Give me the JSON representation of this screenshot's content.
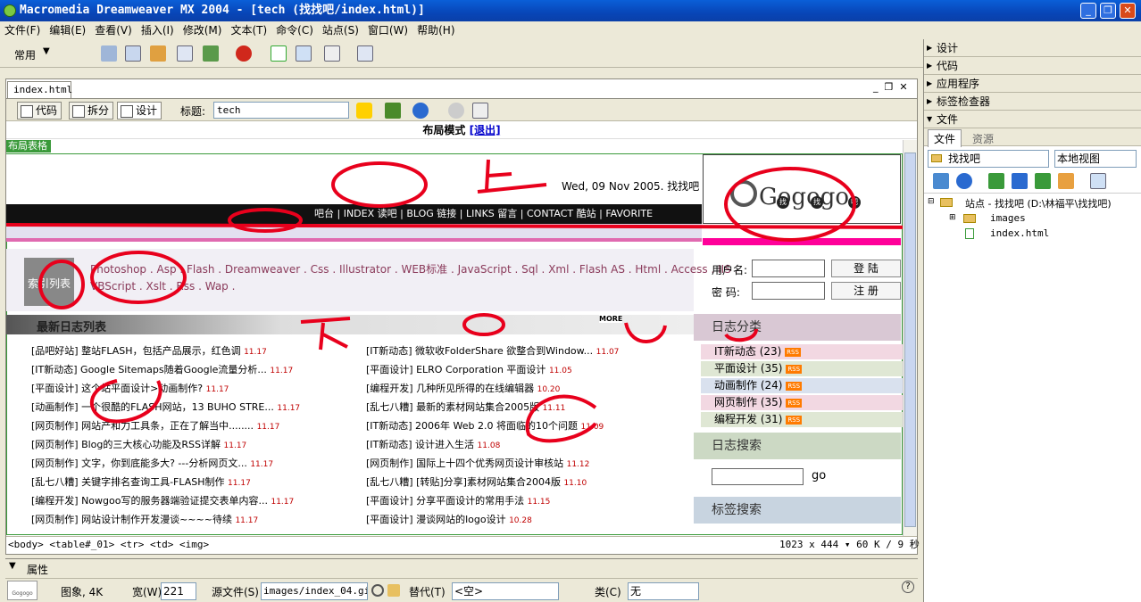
{
  "window": {
    "title": "Macromedia Dreamweaver MX 2004 - [tech (找找吧/index.html)]"
  },
  "menu": [
    "文件(F)",
    "编辑(E)",
    "查看(V)",
    "插入(I)",
    "修改(M)",
    "文本(T)",
    "命令(C)",
    "站点(S)",
    "窗口(W)",
    "帮助(H)"
  ],
  "toolbar": {
    "category": "常用"
  },
  "doc": {
    "tab": "index.html",
    "views": [
      "代码",
      "拆分",
      "设计"
    ],
    "title_label": "标题:",
    "title_value": "tech",
    "layout_mode": "布局模式",
    "exit": "[退出]",
    "layout_table": "布局表格"
  },
  "page": {
    "date": "Wed, 09 Nov 2005. 找找吧",
    "nav": "吧台 | INDEX  读吧 | BLOG  链接 | LINKS  留言 | CONTACT  酷站 | FAVORITE",
    "logo": "Gogogo",
    "logo_chars": [
      "找",
      "找",
      "吧"
    ],
    "index_label": "索引列表",
    "index_line1": "Photoshop . Asp . Flash . Dreamweaver . Css . Illustrator . WEB标准 . JavaScript . Sql . Xml . Flash AS . Html . Access . IIS .",
    "index_line2": "VBScript . Xslt . Rss . Wap .",
    "user_label": "用户名:",
    "pass_label": "密  码:",
    "login_btn": "登  陆",
    "register_btn": "注  册",
    "latest_title": "最新日志列表",
    "more": "MORE",
    "left_list": [
      {
        "t": "[品吧好站] 整站FLASH，包括产品展示，红色调",
        "d": "11.17"
      },
      {
        "t": "[IT新动态] Google Sitemaps随着Google流量分析...",
        "d": "11.17"
      },
      {
        "t": "[平面设计] 这个站平面设计>动画制作?",
        "d": "11.17"
      },
      {
        "t": "[动画制作] 一个很酷的FLASH网站，13 BUHO STRE...",
        "d": "11.17"
      },
      {
        "t": "[网页制作] 网站产和力工具条，正在了解当中........",
        "d": "11.17"
      },
      {
        "t": "[网页制作] Blog的三大核心功能及RSS详解",
        "d": "11.17"
      },
      {
        "t": "[网页制作] 文字，你到底能多大? ---分析网页文...",
        "d": "11.17"
      },
      {
        "t": "[乱七八糟] 关键字排名查询工具-FLASH制作",
        "d": "11.17"
      },
      {
        "t": "[编程开发] Nowgoo写的服务器端验证提交表单内容...",
        "d": "11.17"
      },
      {
        "t": "[网页制作] 网站设计制作开发漫谈~~~~待续",
        "d": "11.17"
      }
    ],
    "right_list": [
      {
        "t": "[IT新动态] 微软收FolderShare  欲整合到Window...",
        "d": "11.07"
      },
      {
        "t": "[平面设计] ELRO Corporation 平面设计",
        "d": "11.05"
      },
      {
        "t": "[编程开发] 几种所见所得的在线编辑器",
        "d": "10.20"
      },
      {
        "t": "[乱七八糟] 最新的素材网站集合2005版",
        "d": "11.11"
      },
      {
        "t": "[IT新动态] 2006年 Web 2.0 将面临的10个问题",
        "d": "11.09"
      },
      {
        "t": "[IT新动态] 设计进入生活",
        "d": "11.08"
      },
      {
        "t": "[网页制作] 国际上十四个优秀网页设计审核站",
        "d": "11.12"
      },
      {
        "t": "[乱七八糟] [转贴]分享]素材网站集合2004版",
        "d": "11.10"
      },
      {
        "t": "[平面设计] 分享平面设计的常用手法",
        "d": "11.15"
      },
      {
        "t": "[平面设计] 漫谈网站的logo设计",
        "d": "10.28"
      }
    ],
    "cat_title": "日志分类",
    "categories": [
      {
        "n": "IT新动态",
        "c": "(23)"
      },
      {
        "n": "平面设计",
        "c": "(35)"
      },
      {
        "n": "动画制作",
        "c": "(24)"
      },
      {
        "n": "网页制作",
        "c": "(35)"
      },
      {
        "n": "编程开发",
        "c": "(31)"
      }
    ],
    "rss": "RSS",
    "search_title": "日志搜索",
    "go": "go",
    "tag_title": "标签搜索"
  },
  "tagsel": {
    "path": "<body> <table#_01> <tr> <td> <img>",
    "status": "1023 x 444 ▾ 60 K / 9 秒"
  },
  "props": {
    "title": "属性",
    "img_label": "图象, 4K",
    "width_label": "宽(W)",
    "width": "221",
    "src_label": "源文件(S)",
    "src": "images/index_04.gif",
    "alt_label": "替代(T)",
    "alt": "<空>",
    "class_label": "类(C)",
    "class": "无"
  },
  "panels": {
    "items": [
      "设计",
      "代码",
      "应用程序",
      "标签检查器"
    ],
    "files": "文件",
    "tabs": [
      "文件",
      "资源"
    ],
    "site": "找找吧",
    "view": "本地视图",
    "tree": [
      "站点 - 找找吧 (D:\\林福平\\找找吧)",
      "images",
      "index.html"
    ]
  }
}
